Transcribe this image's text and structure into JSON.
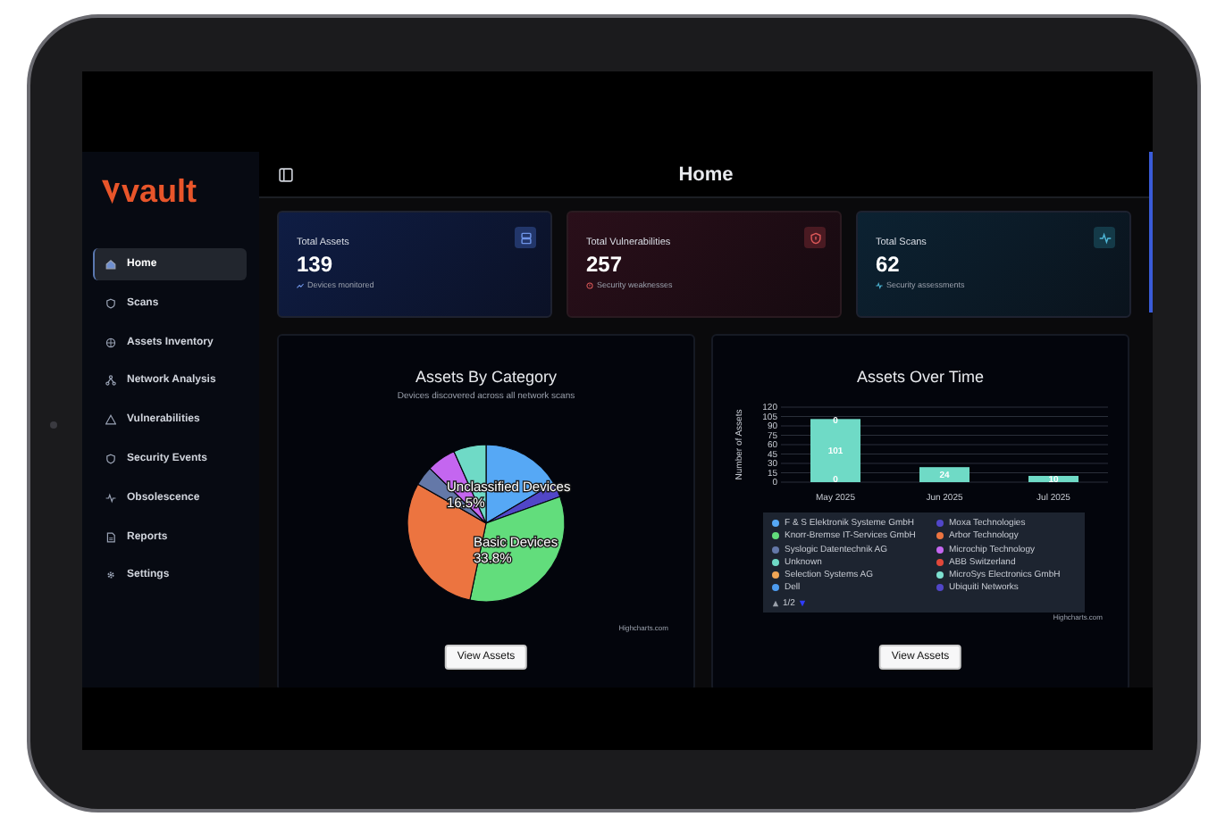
{
  "sidebar": {
    "logo": "vault",
    "items": [
      {
        "label": "Home",
        "selected": true
      },
      {
        "label": "Scans",
        "selected": false
      },
      {
        "label": "Assets Inventory",
        "selected": false
      },
      {
        "label": "Network Analysis",
        "selected": false
      },
      {
        "label": "Vulnerabilities",
        "selected": false
      },
      {
        "label": "Security Events",
        "selected": false
      },
      {
        "label": "Obsolescence",
        "selected": false
      },
      {
        "label": "Reports",
        "selected": false
      },
      {
        "label": "Settings",
        "selected": false
      }
    ]
  },
  "header": {
    "title": "Home"
  },
  "cards": [
    {
      "kind": "assets",
      "title": "Total Assets",
      "value": "139",
      "note": "Devices monitored"
    },
    {
      "kind": "vulnerabilities",
      "title": "Total Vulnerabilities",
      "value": "257",
      "note": "Security weaknesses"
    },
    {
      "kind": "scans",
      "title": "Total Scans",
      "value": "62",
      "note": "Security assessments"
    }
  ],
  "panels": [
    {
      "title": "Assets By Category",
      "subtitle": "Devices discovered across all network scans",
      "chart_data": {
        "type": "pie",
        "categories": [
          "Unclassified Devices",
          null,
          "Basic Devices",
          null,
          null,
          null,
          null
        ],
        "values": [
          16.5,
          3,
          33.8,
          30,
          4,
          6,
          6.7
        ],
        "colors": [
          "#56a8f5",
          "#5146c8",
          "#62dd7c",
          "#ec7440",
          "#6478a8",
          "#c466f0",
          "#6fdac6"
        ],
        "value_labels": [
          "16.5%",
          null,
          "33.8%",
          null,
          null,
          null,
          null
        ]
      },
      "credit": "Highcharts.com",
      "button": "View Assets"
    },
    {
      "title": "Assets Over Time",
      "chart_data": {
        "type": "bar",
        "ylabel": "Number of Assets",
        "categories": [
          "May 2025",
          "Jun 2025",
          "Jul 2025"
        ],
        "ylim": [
          0,
          120
        ],
        "yticks": [
          0,
          15,
          30,
          45,
          60,
          75,
          90,
          105,
          120
        ],
        "grid": true,
        "data_labels": true,
        "series": [
          {
            "color": "#6fdac6",
            "values": [
              101,
              24,
              10
            ]
          }
        ],
        "annotations": [
          {
            "x": "May 2025",
            "y": 99,
            "text": "0"
          },
          {
            "x": "May 2025",
            "y": 5,
            "text": "0"
          }
        ]
      },
      "legend": {
        "items": [
          {
            "label": "F & S Elektronik Systeme GmbH",
            "color": "#56a8f5"
          },
          {
            "label": "Moxa Technologies",
            "color": "#5146c8"
          },
          {
            "label": "Knorr-Bremse IT-Services GmbH",
            "color": "#62dd7c"
          },
          {
            "label": "Arbor Technology",
            "color": "#ec7440"
          },
          {
            "label": "Syslogic Datentechnik AG",
            "color": "#6478a8"
          },
          {
            "label": "Microchip Technology",
            "color": "#c466f0"
          },
          {
            "label": "Unknown",
            "color": "#6fdac6"
          },
          {
            "label": "ABB Switzerland",
            "color": "#e2483a"
          },
          {
            "label": "Selection Systems AG",
            "color": "#f0a655"
          },
          {
            "label": "MicroSys Electronics GmbH",
            "color": "#7de0d0"
          },
          {
            "label": "Dell",
            "color": "#4d9cf0"
          },
          {
            "label": "Ubiquiti Networks",
            "color": "#5146c8"
          }
        ],
        "page": "1/2",
        "previous_disabled": true,
        "next_disabled": false
      },
      "credit": "Highcharts.com",
      "button": "View Assets"
    }
  ]
}
